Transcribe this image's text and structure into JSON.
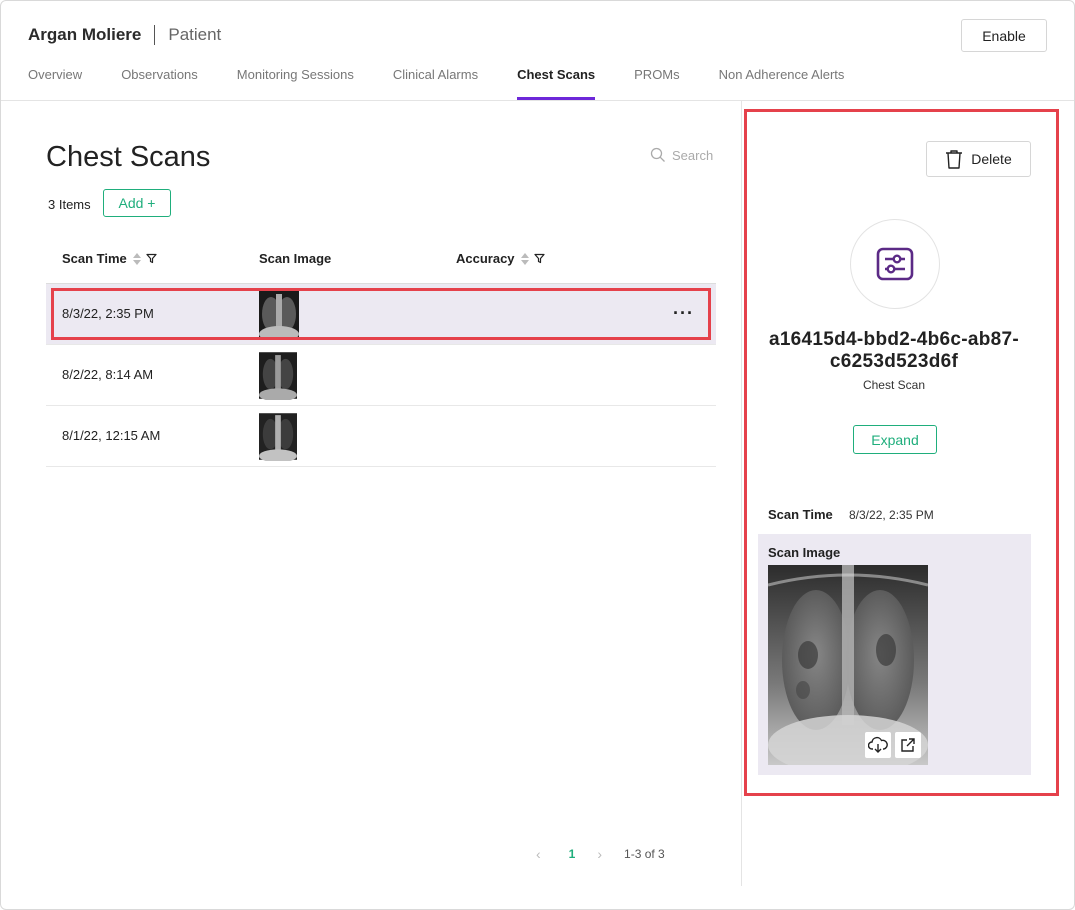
{
  "header": {
    "patient_name": "Argan Moliere",
    "role": "Patient",
    "enable_label": "Enable"
  },
  "tabs": [
    {
      "label": "Overview",
      "active": false
    },
    {
      "label": "Observations",
      "active": false
    },
    {
      "label": "Monitoring Sessions",
      "active": false
    },
    {
      "label": "Clinical Alarms",
      "active": false
    },
    {
      "label": "Chest Scans",
      "active": true
    },
    {
      "label": "PROMs",
      "active": false
    },
    {
      "label": "Non Adherence Alerts",
      "active": false
    }
  ],
  "main": {
    "title": "Chest Scans",
    "search_placeholder": "Search",
    "item_count": "3 Items",
    "add_label": "Add +",
    "columns": [
      "Scan Time",
      "Scan Image",
      "Accuracy"
    ],
    "rows": [
      {
        "scan_time": "8/3/22, 2:35 PM",
        "accuracy": "",
        "selected": true
      },
      {
        "scan_time": "8/2/22, 8:14 AM",
        "accuracy": "",
        "selected": false
      },
      {
        "scan_time": "8/1/22, 12:15 AM",
        "accuracy": "",
        "selected": false
      }
    ],
    "row_menu": "···"
  },
  "pagination": {
    "prev": "‹",
    "current_page": "1",
    "next": "›",
    "range": "1-3 of 3"
  },
  "detail": {
    "delete_label": "Delete",
    "record_id_line1": "a16415d4-bbd2-4b6c-ab87-",
    "record_id_line2": "c6253d523d6f",
    "record_type": "Chest Scan",
    "expand_label": "Expand",
    "scan_time_label": "Scan Time",
    "scan_time_value": "8/3/22, 2:35 PM",
    "scan_image_label": "Scan Image"
  },
  "colors": {
    "accent_purple": "#6d28d9",
    "accent_green": "#1fae7c",
    "highlight_red": "#e5414b",
    "selected_row": "#ece9f2"
  }
}
